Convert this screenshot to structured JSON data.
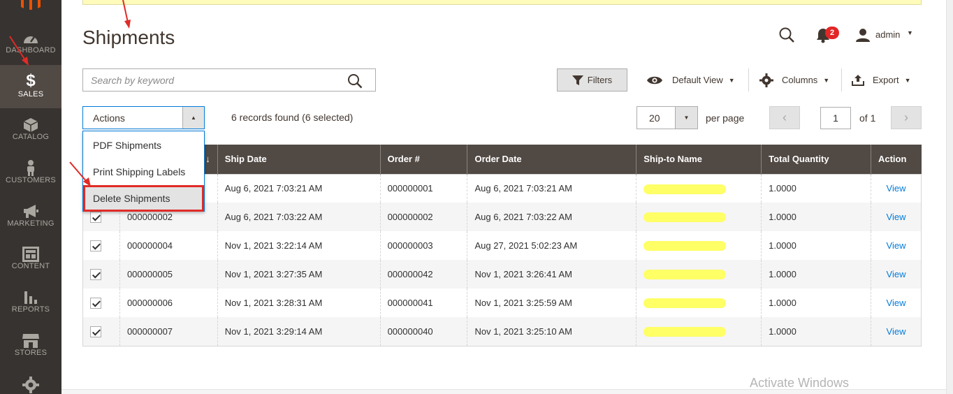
{
  "sidebar": {
    "items": [
      {
        "label": "DASHBOARD",
        "icon": "dashboard-icon"
      },
      {
        "label": "SALES",
        "icon": "dollar-icon",
        "glyph": "$"
      },
      {
        "label": "CATALOG",
        "icon": "cube-icon"
      },
      {
        "label": "CUSTOMERS",
        "icon": "person-icon"
      },
      {
        "label": "MARKETING",
        "icon": "megaphone-icon"
      },
      {
        "label": "CONTENT",
        "icon": "layout-icon"
      },
      {
        "label": "REPORTS",
        "icon": "bar-chart-icon"
      },
      {
        "label": "STORES",
        "icon": "storefront-icon"
      }
    ]
  },
  "header": {
    "title": "Shipments",
    "notifications_count": "2",
    "user": "admin"
  },
  "search": {
    "placeholder": "Search by keyword"
  },
  "toolbar": {
    "filters_label": "Filters",
    "view_label": "Default View",
    "columns_label": "Columns",
    "export_label": "Export"
  },
  "actions": {
    "label": "Actions",
    "options": [
      "PDF Shipments",
      "Print Shipping Labels",
      "Delete Shipments"
    ],
    "highlighted": "Delete Shipments"
  },
  "records_text": "6 records found (6 selected)",
  "pagination": {
    "per_page_value": "20",
    "per_page_label": "per page",
    "current_page": "1",
    "of_label": "of 1"
  },
  "grid": {
    "columns": [
      "",
      "",
      "Ship Date",
      "Order #",
      "Order Date",
      "Ship-to Name",
      "Total Quantity",
      "Action"
    ],
    "sort_icon": "↓",
    "rows": [
      {
        "id": "",
        "ship_date": "Aug 6, 2021 7:03:21 AM",
        "order": "000000001",
        "order_date": "Aug 6, 2021 7:03:21 AM",
        "qty": "1.0000",
        "action": "View"
      },
      {
        "id": "000000002",
        "ship_date": "Aug 6, 2021 7:03:22 AM",
        "order": "000000002",
        "order_date": "Aug 6, 2021 7:03:22 AM",
        "qty": "1.0000",
        "action": "View"
      },
      {
        "id": "000000004",
        "ship_date": "Nov 1, 2021 3:22:14 AM",
        "order": "000000003",
        "order_date": "Aug 27, 2021 5:02:23 AM",
        "qty": "1.0000",
        "action": "View"
      },
      {
        "id": "000000005",
        "ship_date": "Nov 1, 2021 3:27:35 AM",
        "order": "000000042",
        "order_date": "Nov 1, 2021 3:26:41 AM",
        "qty": "1.0000",
        "action": "View"
      },
      {
        "id": "000000006",
        "ship_date": "Nov 1, 2021 3:28:31 AM",
        "order": "000000041",
        "order_date": "Nov 1, 2021 3:25:59 AM",
        "qty": "1.0000",
        "action": "View"
      },
      {
        "id": "000000007",
        "ship_date": "Nov 1, 2021 3:29:14 AM",
        "order": "000000040",
        "order_date": "Nov 1, 2021 3:25:10 AM",
        "qty": "1.0000",
        "action": "View"
      }
    ]
  },
  "watermark": "Activate Windows",
  "colors": {
    "sidebar_bg": "#373330",
    "sidebar_active": "#514943",
    "grid_header": "#514943",
    "link": "#007bdb",
    "annotation_red": "#e02b27",
    "redaction_yellow": "#ffff66"
  }
}
